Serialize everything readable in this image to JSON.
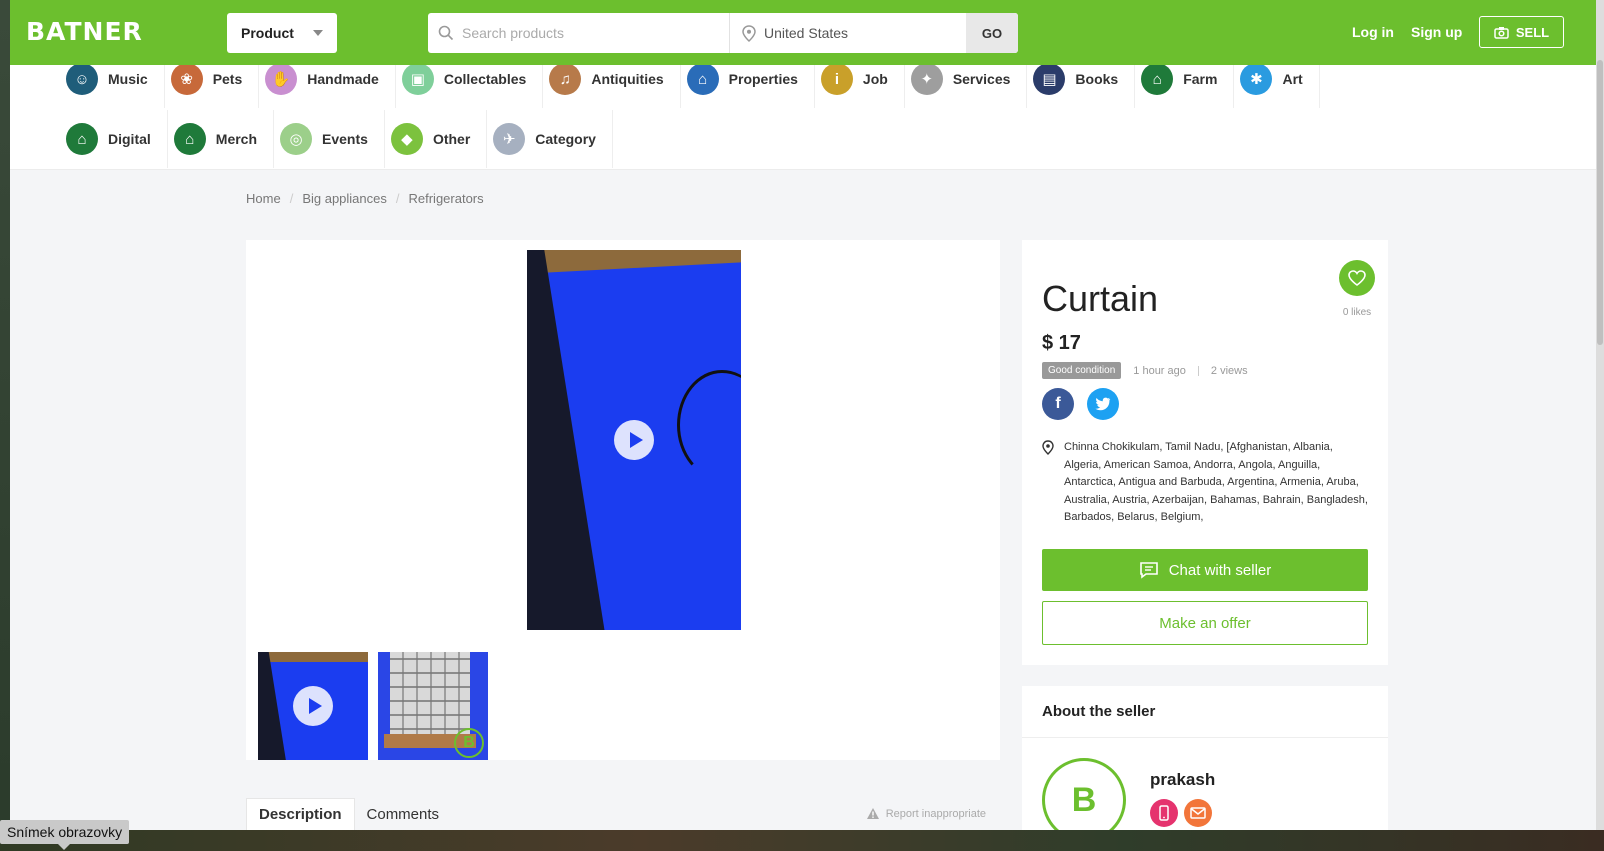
{
  "header": {
    "logo": "BATNER",
    "product_select": "Product",
    "search_placeholder": "Search products",
    "location_value": "United States",
    "go_label": "GO",
    "login_label": "Log in",
    "signup_label": "Sign up",
    "sell_label": "SELL",
    "brand_color": "#6cbf2e"
  },
  "categories": {
    "row1": [
      {
        "label": "Music",
        "icon": "ghost-icon",
        "color": "#1f5d7a"
      },
      {
        "label": "Pets",
        "icon": "rabbit-icon",
        "color": "#c7693a"
      },
      {
        "label": "Handmade",
        "icon": "hands-icon",
        "color": "#c98fd0"
      },
      {
        "label": "Collectables",
        "icon": "frame-icon",
        "color": "#7fcf9a"
      },
      {
        "label": "Antiquities",
        "icon": "gramophone-icon",
        "color": "#b77a4a"
      },
      {
        "label": "Properties",
        "icon": "house-icon",
        "color": "#2a6cb8"
      },
      {
        "label": "Job",
        "icon": "info-icon",
        "color": "#c9a02a"
      },
      {
        "label": "Services",
        "icon": "handshake-icon",
        "color": "#9e9e9e"
      },
      {
        "label": "Books",
        "icon": "book-icon",
        "color": "#2b3c6a"
      },
      {
        "label": "Farm",
        "icon": "house-icon",
        "color": "#1f7a3a"
      },
      {
        "label": "Art",
        "icon": "palette-icon",
        "color": "#2a9be0"
      }
    ],
    "row2": [
      {
        "label": "Digital",
        "icon": "house-icon",
        "color": "#1f7a3a"
      },
      {
        "label": "Merch",
        "icon": "house-icon",
        "color": "#1f7a3a"
      },
      {
        "label": "Events",
        "icon": "target-icon",
        "color": "#9ccf8a"
      },
      {
        "label": "Other",
        "icon": "tag-icon",
        "color": "#7cc23e"
      },
      {
        "label": "Category",
        "icon": "bird-icon",
        "color": "#a6b0c0"
      }
    ]
  },
  "breadcrumb": [
    "Home",
    "Big appliances",
    "Refrigerators"
  ],
  "product": {
    "title": "Curtain",
    "price": "$ 17",
    "condition": "Good condition",
    "posted": "1 hour ago",
    "views": "2 views",
    "likes": "0 likes",
    "location": "Chinna Chokikulam, Tamil Nadu, [Afghanistan, Albania, Algeria, American Samoa, Andorra, Angola, Anguilla, Antarctica, Antigua and Barbuda, Argentina, Armenia, Aruba, Australia, Austria, Azerbaijan, Bahamas, Bahrain, Bangladesh, Barbados, Belarus, Belgium,",
    "chat_label": "Chat with seller",
    "offer_label": "Make an offer"
  },
  "tabs": [
    "Description",
    "Comments"
  ],
  "report_label": "Report inappropriate",
  "seller": {
    "heading": "About the seller",
    "name": "prakash"
  },
  "desktop": {
    "tooltip": "Snímek obrazovky"
  }
}
